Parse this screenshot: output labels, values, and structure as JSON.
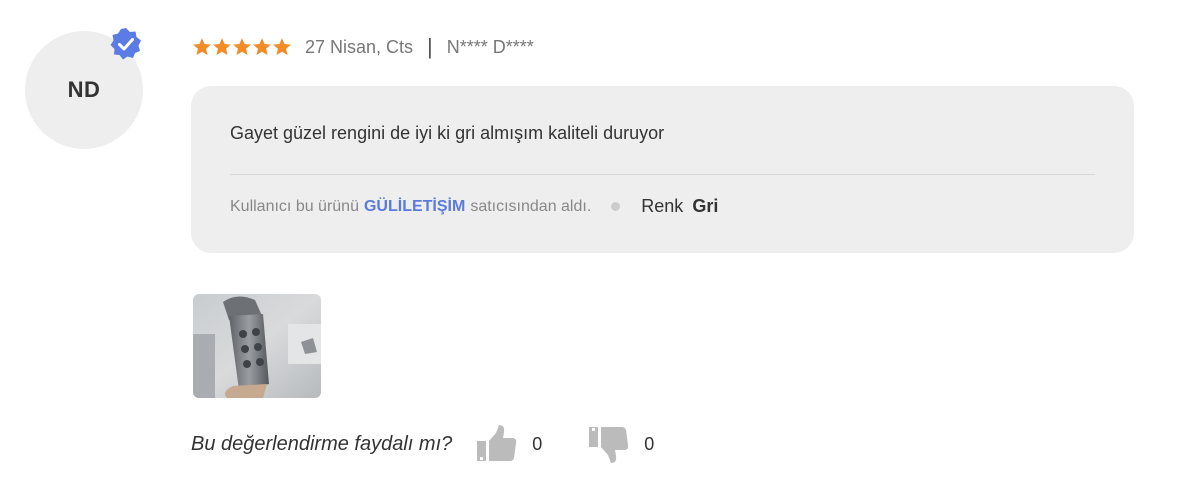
{
  "reviewer": {
    "initials": "ND",
    "masked_name": "N**** D****",
    "verified": true
  },
  "review": {
    "rating": 5,
    "date": "27 Nisan, Cts",
    "divider": "|",
    "text": "Gayet güzel rengini de iyi ki gri almışım kaliteli duruyor"
  },
  "seller_info": {
    "prefix": "Kullanıcı bu ürünü",
    "seller": "GÜLİLETİŞİM",
    "suffix": "satıcısından aldı."
  },
  "attributes": [
    {
      "label": "Renk",
      "value": "Gri"
    }
  ],
  "helpful": {
    "question": "Bu değerlendirme faydalı mı?",
    "likes": "0",
    "dislikes": "0"
  },
  "colors": {
    "star": "#F28C28",
    "verified_badge": "#5B7BE5",
    "seller_link": "#5A7BDD",
    "comment_bg": "#EEEEEE",
    "icon_gray": "#BBBBBB"
  },
  "icons": {
    "verified": "verified-badge-icon",
    "star": "star-icon",
    "like": "thumbs-up-icon",
    "dislike": "thumbs-down-icon"
  }
}
